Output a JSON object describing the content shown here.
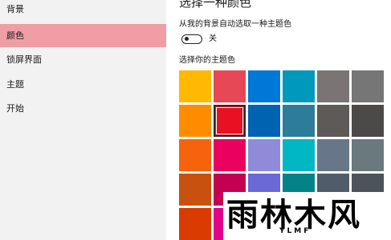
{
  "sidebar": {
    "items": [
      {
        "label": "背景",
        "active": false
      },
      {
        "label": "颜色",
        "active": true
      },
      {
        "label": "锁屏界面",
        "active": false
      },
      {
        "label": "主题",
        "active": false
      },
      {
        "label": "开始",
        "active": false
      }
    ]
  },
  "main": {
    "heading": "选择一种颜色",
    "auto_pick_label": "从我的背景自动选取一种主题色",
    "toggle": {
      "state_label": "关",
      "on": false
    },
    "theme_color_label": "选择你的主题色",
    "swatch_colors": [
      [
        "#ffb900",
        "#e74856",
        "#0078d7",
        "#0099bc",
        "#7a7574",
        "#767676"
      ],
      [
        "#ff8c00",
        "#e81123",
        "#0063b1",
        "#2d7d9a",
        "#5d5a58",
        "#4c4a48"
      ],
      [
        "#f7630c",
        "#ea005e",
        "#8e8cd8",
        "#00b7c3",
        "#68768a",
        "#69797e"
      ],
      [
        "#ca5010",
        "#c30052",
        "#6b69d6",
        "#038387",
        "#515c6b",
        "#4a5459"
      ],
      [
        "#da3b01",
        "#e3008c",
        "#8764b8",
        "#00b294",
        "#567c73",
        "#647c64"
      ]
    ],
    "selected_swatch": "#e81123"
  },
  "watermark": {
    "logo_text": "雨林木风",
    "sub_text": "YLMF"
  }
}
